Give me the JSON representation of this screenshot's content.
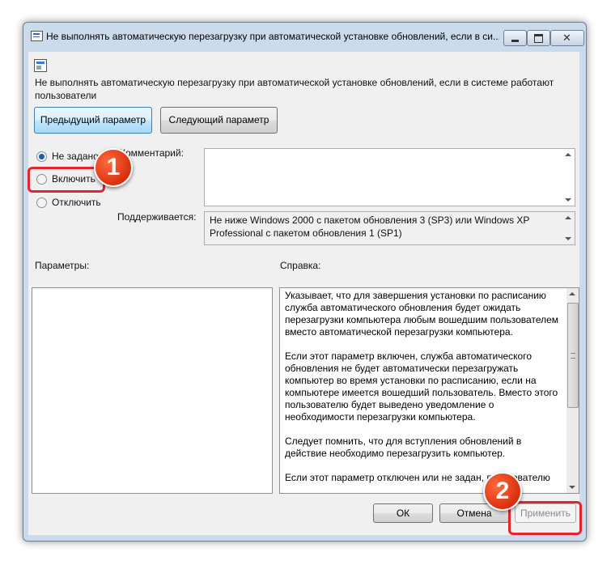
{
  "window": {
    "title": "Не выполнять автоматическую перезагрузку при автоматической установке обновлений, если в си..."
  },
  "setting": {
    "title": "Не выполнять автоматическую перезагрузку при автоматической установке обновлений, если в системе работают пользователи",
    "icon": "policy-setting-icon"
  },
  "nav": {
    "prev": "Предыдущий параметр",
    "next": "Следующий параметр"
  },
  "state": {
    "options": [
      "Не задано",
      "Включить",
      "Отключить"
    ],
    "selected": "Не задано"
  },
  "comment": {
    "label": "Комментарий:",
    "value": ""
  },
  "supported": {
    "label": "Поддерживается:",
    "value": "Не ниже Windows 2000 с пакетом обновления 3 (SP3) или Windows XP Professional с пакетом обновления 1 (SP1)"
  },
  "params": {
    "label": "Параметры:"
  },
  "help": {
    "label": "Справка:",
    "text": "Указывает, что для завершения установки по расписанию служба автоматического обновления будет ожидать перезагрузки компьютера любым вошедшим пользователем вместо автоматической перезагрузки компьютера.\n\nЕсли этот параметр включен, служба автоматического обновления не будет автоматически перезагружать компьютер во время установки по расписанию, если на компьютере имеется вошедший пользователь. Вместо этого пользователю будет выведено уведомление о необходимости перезагрузки компьютера.\n\nСледует помнить, что для вступления обновлений в действие необходимо перезагрузить компьютер.\n\nЕсли этот параметр отключен или не задан, пользователю"
  },
  "footer": {
    "ok": "ОК",
    "cancel": "Отмена",
    "apply": "Применить"
  },
  "annotations": {
    "badge1": "1",
    "badge2": "2",
    "color": "#e3252d"
  }
}
